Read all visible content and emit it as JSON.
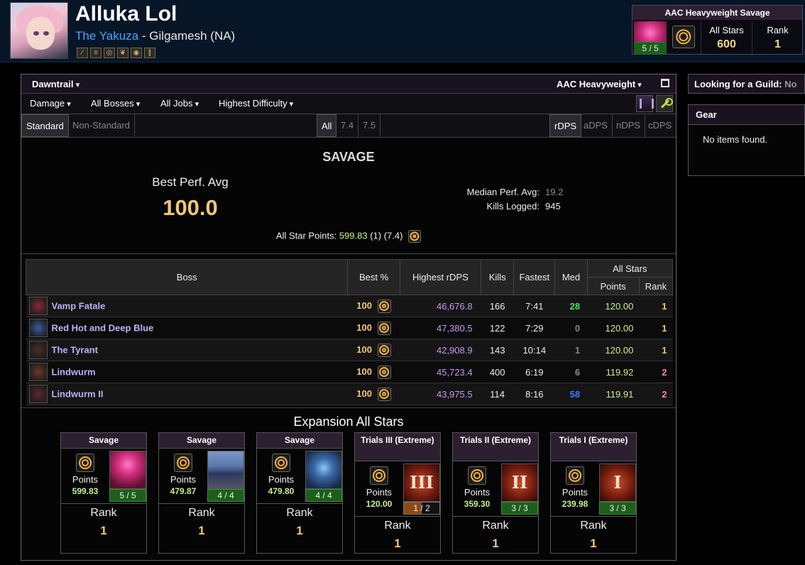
{
  "character": {
    "name": "Alluka Lol",
    "guild": "The Yakuza",
    "separator": "-",
    "server": "Gilgamesh (NA)",
    "job_icons": [
      "job-icon-1",
      "job-icon-2",
      "job-icon-3",
      "job-icon-4",
      "job-icon-5",
      "job-icon-6"
    ]
  },
  "header_tier": {
    "title": "AAC Heavyweight Savage",
    "progress": "5 / 5",
    "all_stars_label": "All Stars",
    "all_stars_value": "600",
    "rank_label": "Rank",
    "rank_value": "1"
  },
  "filters": {
    "expansion": "Dawntrail",
    "zone": "AAC Heavyweight",
    "metric": "Damage",
    "bosses": "All Bosses",
    "jobs": "All Jobs",
    "difficulty": "Highest Difficulty",
    "partition_tabs": [
      "Standard",
      "Non-Standard"
    ],
    "patch_tabs": [
      "All",
      "7.4",
      "7.5"
    ],
    "dps_tabs": [
      "rDPS",
      "aDPS",
      "nDPS",
      "cDPS"
    ]
  },
  "summary": {
    "section_title": "SAVAGE",
    "best_perf_label": "Best Perf. Avg",
    "best_perf_value": "100.0",
    "median_label": "Median Perf. Avg:",
    "median_value": "19.2",
    "kills_label": "Kills Logged:",
    "kills_value": "945",
    "asp_label": "All Star Points:",
    "asp_value": "599.83",
    "asp_rank": "(1)",
    "asp_patch": "(7.4)"
  },
  "table": {
    "headers": {
      "boss": "Boss",
      "best": "Best %",
      "dps": "Highest rDPS",
      "kills": "Kills",
      "fastest": "Fastest",
      "med": "Med",
      "all_stars": "All Stars",
      "points": "Points",
      "rank": "Rank"
    },
    "rows": [
      {
        "boss": "Vamp Fatale",
        "best": "100",
        "dps": "46,676.8",
        "kills": "166",
        "fastest": "7:41",
        "med": "28",
        "med_color": "#4fe24f",
        "points": "120.00",
        "rank": "1",
        "rank_color": "#f0c775"
      },
      {
        "boss": "Red Hot and Deep Blue",
        "best": "100",
        "dps": "47,380.5",
        "kills": "122",
        "fastest": "7:29",
        "med": "0",
        "med_color": "#8a8a8a",
        "points": "120.00",
        "rank": "1",
        "rank_color": "#f0c775"
      },
      {
        "boss": "The Tyrant",
        "best": "100",
        "dps": "42,908.9",
        "kills": "143",
        "fastest": "10:14",
        "med": "1",
        "med_color": "#8a8a8a",
        "points": "120.00",
        "rank": "1",
        "rank_color": "#f0c775"
      },
      {
        "boss": "Lindwurm",
        "best": "100",
        "dps": "45,723.4",
        "kills": "400",
        "fastest": "6:19",
        "med": "6",
        "med_color": "#8a8a8a",
        "points": "119.92",
        "rank": "2",
        "rank_color": "#ff7eb6"
      },
      {
        "boss": "Lindwurm II",
        "best": "100",
        "dps": "43,975.5",
        "kills": "114",
        "fastest": "8:16",
        "med": "58",
        "med_color": "#3b7cff",
        "points": "119.91",
        "rank": "2",
        "rank_color": "#ff7eb6"
      }
    ]
  },
  "expansion": {
    "title": "Expansion All Stars",
    "cards": [
      {
        "title": "Savage",
        "points_label": "Points",
        "points": "599.83",
        "progress": "5 / 5",
        "rank_label": "Rank",
        "rank": "1",
        "image": "pinkimg",
        "roman": ""
      },
      {
        "title": "Savage",
        "points_label": "Points",
        "points": "479.87",
        "progress": "4 / 4",
        "rank_label": "Rank",
        "rank": "1",
        "image": "img-city",
        "roman": ""
      },
      {
        "title": "Savage",
        "points_label": "Points",
        "points": "479.80",
        "progress": "4 / 4",
        "rank_label": "Rank",
        "rank": "1",
        "image": "img-boss",
        "roman": ""
      },
      {
        "title": "Trials III (Extreme)",
        "points_label": "Points",
        "points": "120.00",
        "progress": "1 / 2",
        "rank_label": "Rank",
        "rank": "1",
        "image": "img-roman",
        "roman": "III"
      },
      {
        "title": "Trials II (Extreme)",
        "points_label": "Points",
        "points": "359.30",
        "progress": "3 / 3",
        "rank_label": "Rank",
        "rank": "1",
        "image": "img-roman",
        "roman": "II"
      },
      {
        "title": "Trials I (Extreme)",
        "points_label": "Points",
        "points": "239.98",
        "progress": "3 / 3",
        "rank_label": "Rank",
        "rank": "1",
        "image": "img-roman",
        "roman": "I"
      }
    ]
  },
  "sidebar": {
    "lfg_label": "Looking for a Guild:",
    "lfg_value": "No",
    "gear_title": "Gear",
    "gear_empty": "No items found."
  }
}
